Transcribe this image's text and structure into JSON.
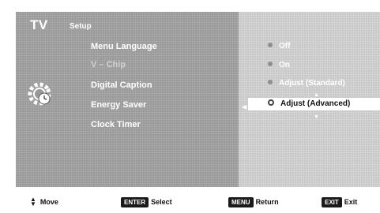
{
  "header": {
    "title": "TV",
    "section": "Setup"
  },
  "menu": {
    "items": [
      {
        "label": "Menu Language",
        "enabled": true
      },
      {
        "label": "V – Chip",
        "enabled": false
      },
      {
        "label": "Digital Caption",
        "enabled": true
      },
      {
        "label": "Energy Saver",
        "enabled": true
      },
      {
        "label": "Clock Timer",
        "enabled": true
      }
    ]
  },
  "options": {
    "items": [
      {
        "label": "Off"
      },
      {
        "label": "On"
      },
      {
        "label": "Adjust (Standard)"
      },
      {
        "label": "Adjust (Advanced)"
      }
    ],
    "selected_label": "Adjust (Advanced)"
  },
  "footer": {
    "move_label": "Move",
    "enter_key": "ENTER",
    "enter_label": "Select",
    "menu_key": "MENU",
    "menu_label": "Return",
    "exit_key": "EXIT",
    "exit_label": "Exit"
  },
  "colors": {
    "panel_bg": "#9a9a9a",
    "option_panel_bg": "#c9c9c9",
    "selection_bg": "#ffffff"
  },
  "icons": {
    "category_icon": "gear-clock-icon",
    "navigate_icon": "up-down-arrows-icon"
  }
}
